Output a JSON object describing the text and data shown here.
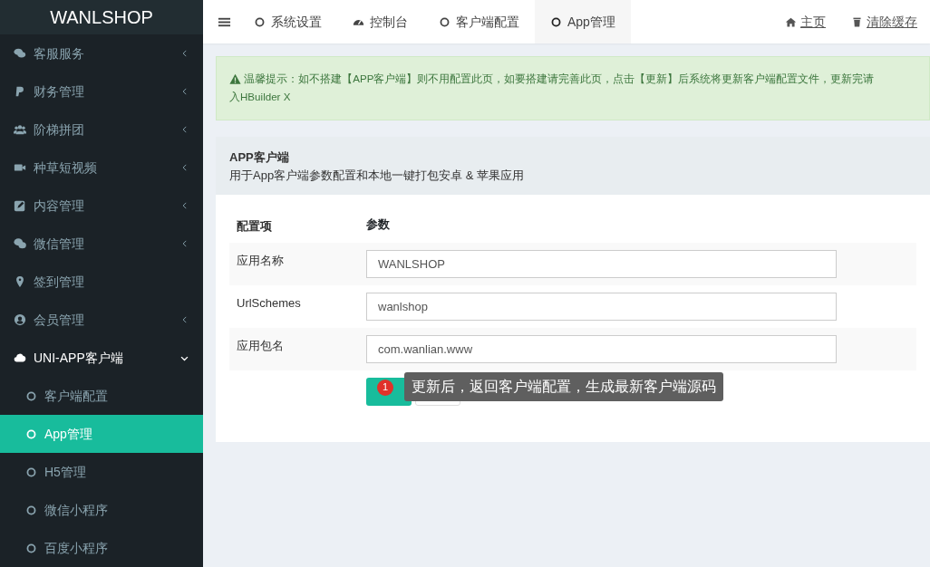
{
  "logo": "WANLSHOP",
  "sidebar": {
    "items": [
      {
        "label": "客服服务",
        "expandable": true,
        "expanded": false,
        "selected": false
      },
      {
        "label": "财务管理",
        "expandable": true,
        "expanded": false,
        "selected": false
      },
      {
        "label": "阶梯拼团",
        "expandable": true,
        "expanded": false,
        "selected": false
      },
      {
        "label": "种草短视频",
        "expandable": true,
        "expanded": false,
        "selected": false
      },
      {
        "label": "内容管理",
        "expandable": true,
        "expanded": false,
        "selected": false
      },
      {
        "label": "微信管理",
        "expandable": true,
        "expanded": false,
        "selected": false
      },
      {
        "label": "签到管理",
        "expandable": false,
        "expanded": false,
        "selected": false
      },
      {
        "label": "会员管理",
        "expandable": true,
        "expanded": false,
        "selected": false
      },
      {
        "label": "UNI-APP客户端",
        "expandable": true,
        "expanded": true,
        "selected": false,
        "children": [
          {
            "label": "客户端配置",
            "selected": false
          },
          {
            "label": "App管理",
            "selected": true
          },
          {
            "label": "H5管理",
            "selected": false
          },
          {
            "label": "微信小程序",
            "selected": false
          },
          {
            "label": "百度小程序",
            "selected": false
          }
        ]
      }
    ]
  },
  "tabs": [
    {
      "label": "系统设置",
      "selected": false
    },
    {
      "label": "控制台",
      "selected": false
    },
    {
      "label": "客户端配置",
      "selected": false
    },
    {
      "label": "App管理",
      "selected": true
    }
  ],
  "header_links": [
    {
      "label": "主页"
    },
    {
      "label": "清除缓存"
    }
  ],
  "alert": {
    "lines": [
      "温馨提示：如不搭建【APP客户端】则不用配置此页，如要搭建请完善此页，点击【更新】后系统将更新客户端配置文件，更新完请",
      "入HBuilder X"
    ]
  },
  "panel": {
    "title": "APP客户端",
    "subtitle": "用于App客户端参数配置和本地一键打包安卓 & 苹果应用"
  },
  "table": {
    "columns": [
      "配置项",
      "参数"
    ],
    "rows": [
      {
        "label": "应用名称",
        "value": "WANLSHOP"
      },
      {
        "label": "UrlSchemes",
        "value": "wanlshop"
      },
      {
        "label": "应用包名",
        "value": "com.wanlian.www"
      }
    ]
  },
  "tooltip": {
    "badge": "1",
    "text": "更新后，返回客户端配置，生成最新客户端源码"
  }
}
